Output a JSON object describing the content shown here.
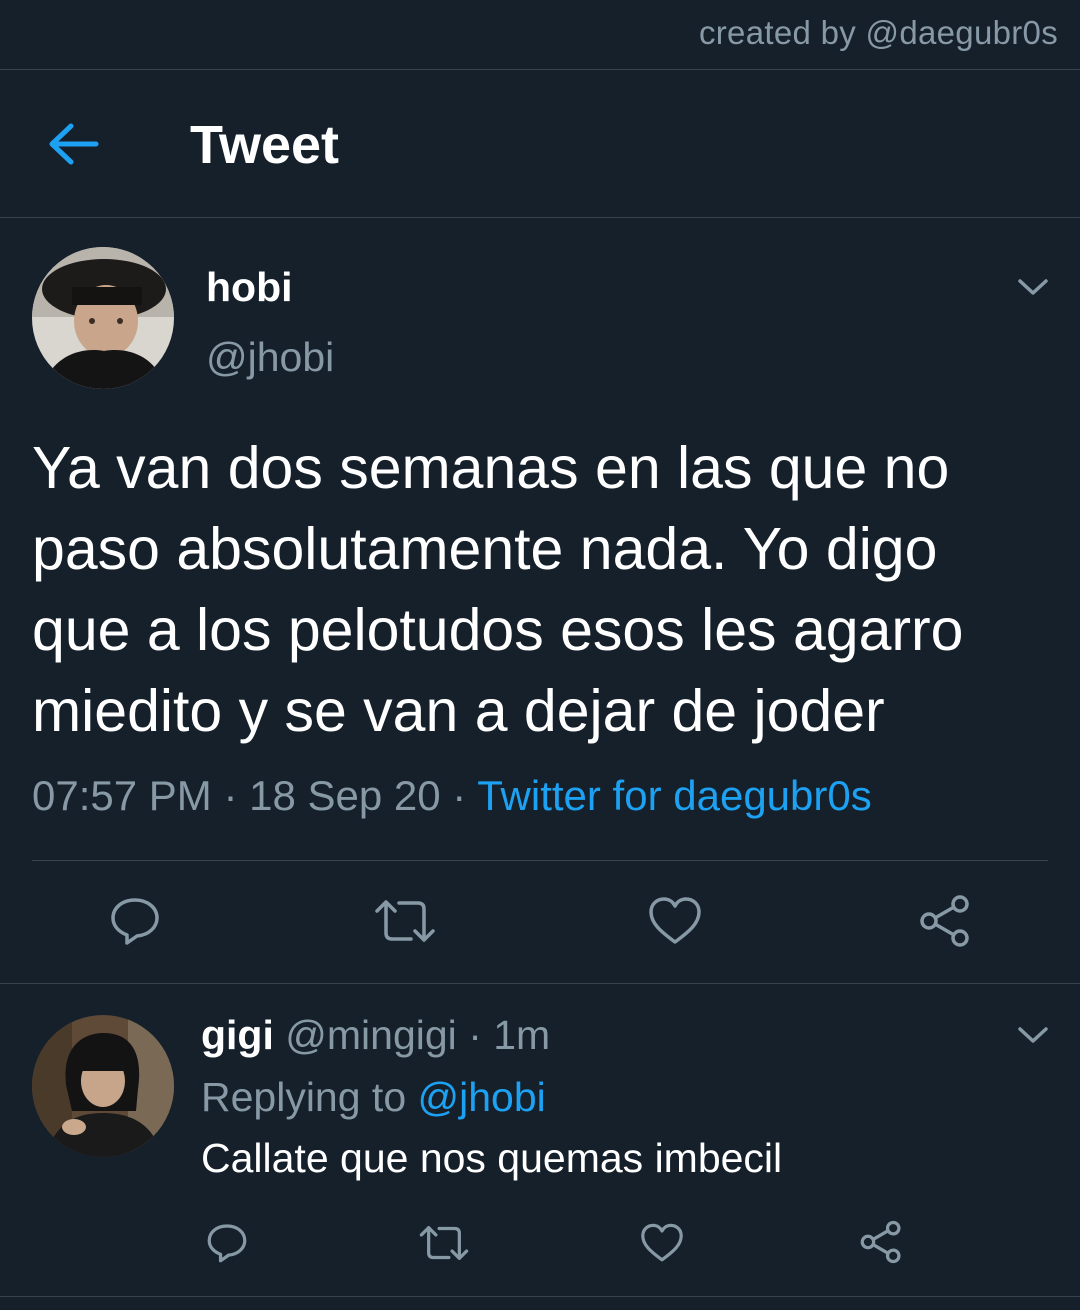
{
  "credit": "created by @daegubr0s",
  "header": {
    "title": "Tweet",
    "back_icon": "arrow-left-icon"
  },
  "tweet": {
    "name": "hobi",
    "handle": "@jhobi",
    "text": "Ya van dos semanas en las que no\npaso absolutamente nada. Yo digo\nque a los pelotudos esos les agarro\nmiedito y se van a dejar de joder",
    "time": "07:57 PM",
    "sep1": " · ",
    "date": "18 Sep 20",
    "sep2": " · ",
    "source": "Twitter for daegubr0s",
    "actions": [
      "comment-icon",
      "retweet-icon",
      "heart-icon",
      "share-icon"
    ]
  },
  "reply": {
    "name": "gigi",
    "handle": "@mingigi",
    "sep": " · ",
    "time": "1m",
    "replying_prefix": "Replying to ",
    "replying_to": "@jhobi",
    "text": "Callate que nos quemas imbecil",
    "actions": [
      "comment-icon",
      "retweet-icon",
      "heart-icon",
      "share-icon"
    ]
  },
  "colors": {
    "background": "#15202b",
    "accent": "#1da1f2",
    "secondary_text": "#8899a6",
    "divider": "#38444d"
  }
}
